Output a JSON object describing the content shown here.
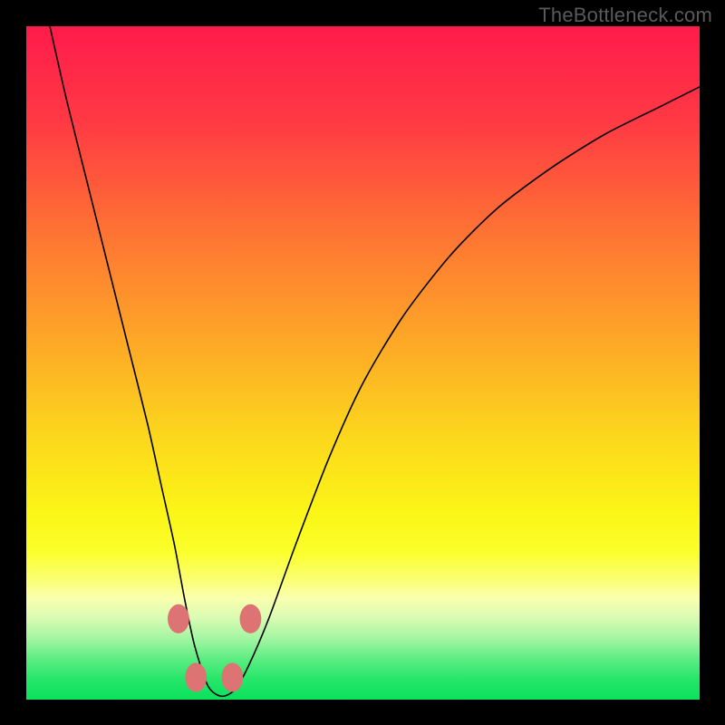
{
  "watermark": {
    "text": "TheBottleneck.com"
  },
  "chart_data": {
    "type": "line",
    "title": "",
    "xlabel": "",
    "ylabel": "",
    "xlim": [
      0,
      100
    ],
    "ylim": [
      0,
      100
    ],
    "grid": false,
    "legend": false,
    "series": [
      {
        "name": "curve",
        "x": [
          3.5,
          6,
          9,
          12,
          15,
          18,
          20,
          22,
          23.5,
          25,
          27,
          29,
          31,
          33,
          36,
          40,
          45,
          50,
          56,
          63,
          70,
          78,
          86,
          94,
          100
        ],
        "y": [
          100,
          89,
          77,
          65,
          53,
          41,
          32,
          23,
          15,
          8,
          2,
          0.5,
          1.5,
          5,
          12,
          23,
          36,
          47,
          57,
          66,
          73,
          79,
          84,
          88,
          91
        ]
      }
    ],
    "markers": [
      {
        "name": "node-left-upper",
        "x": 22.6,
        "y": 12.0,
        "r": 1.6
      },
      {
        "name": "node-left-lower",
        "x": 25.2,
        "y": 3.3,
        "r": 1.6
      },
      {
        "name": "node-right-lower",
        "x": 30.6,
        "y": 3.3,
        "r": 1.6
      },
      {
        "name": "node-right-upper",
        "x": 33.3,
        "y": 12.0,
        "r": 1.6
      }
    ],
    "gradient_stops": [
      {
        "pct": 0,
        "color": "#ff1b4b"
      },
      {
        "pct": 14,
        "color": "#ff3944"
      },
      {
        "pct": 30,
        "color": "#fe7134"
      },
      {
        "pct": 45,
        "color": "#fda228"
      },
      {
        "pct": 60,
        "color": "#fcd41d"
      },
      {
        "pct": 72,
        "color": "#fbf516"
      },
      {
        "pct": 78,
        "color": "#fbff2a"
      },
      {
        "pct": 82,
        "color": "#fbff70"
      },
      {
        "pct": 85,
        "color": "#faffb0"
      },
      {
        "pct": 88,
        "color": "#d7fbb2"
      },
      {
        "pct": 91,
        "color": "#a1f5a2"
      },
      {
        "pct": 94,
        "color": "#5ced82"
      },
      {
        "pct": 97,
        "color": "#26e66a"
      },
      {
        "pct": 100,
        "color": "#0be15c"
      }
    ],
    "marker_color": "#dd7373",
    "curve_color": "#000000"
  }
}
